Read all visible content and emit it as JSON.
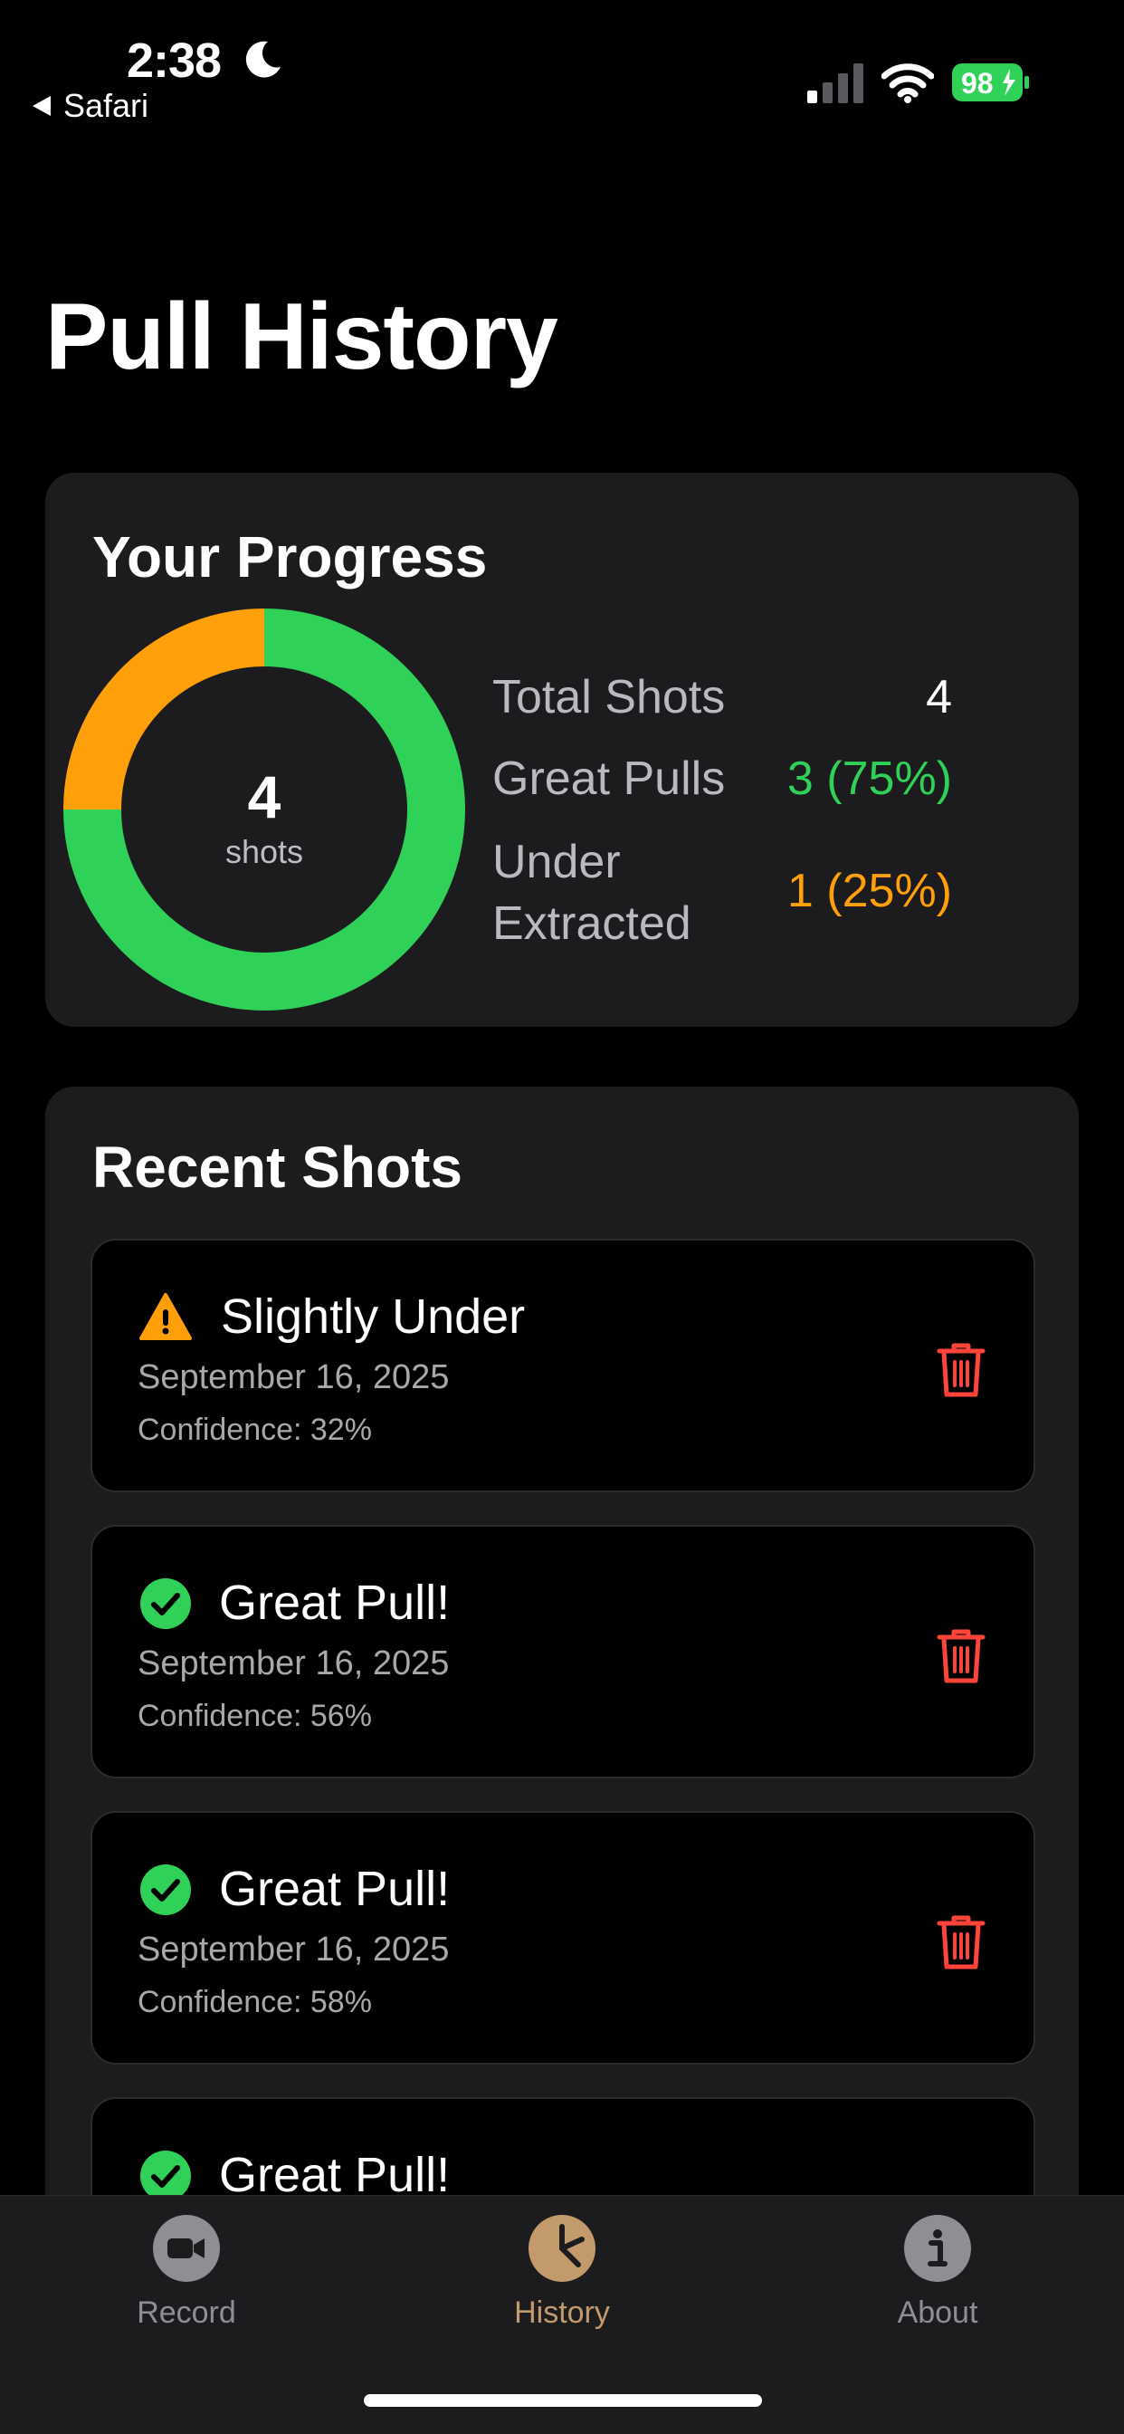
{
  "status_bar": {
    "time": "2:38",
    "back_label": "Safari",
    "battery_level": "98"
  },
  "page": {
    "title": "Pull History"
  },
  "progress": {
    "title": "Your Progress",
    "donut_count": "4",
    "donut_unit": "shots",
    "stats": [
      {
        "label": "Total Shots",
        "value": "4"
      },
      {
        "label": "Great Pulls",
        "value": "3 (75%)"
      },
      {
        "label_line1": "Under",
        "label_line2": "Extracted",
        "value": "1 (25%)"
      }
    ],
    "chart_data": {
      "type": "pie",
      "categories": [
        "Great Pulls",
        "Under Extracted"
      ],
      "values": [
        3,
        1
      ],
      "colors": [
        "#30d158",
        "#ff9f0a"
      ]
    }
  },
  "recent": {
    "title": "Recent Shots",
    "shots": [
      {
        "title": "Slightly Under",
        "date": "September 16, 2025",
        "confidence": "Confidence: 32%",
        "status_icon": "warning-triangle-icon"
      },
      {
        "title": "Great Pull!",
        "date": "September 16, 2025",
        "confidence": "Confidence: 56%",
        "status_icon": "check-circle-icon"
      },
      {
        "title": "Great Pull!",
        "date": "September 16, 2025",
        "confidence": "Confidence: 58%",
        "status_icon": "check-circle-icon"
      },
      {
        "title": "Great Pull!",
        "status_icon": "check-circle-icon"
      }
    ]
  },
  "tabs": [
    {
      "label": "Record",
      "icon": "video-camera-icon"
    },
    {
      "label": "History",
      "icon": "pie-chart-icon",
      "active": true
    },
    {
      "label": "About",
      "icon": "info-icon"
    }
  ],
  "colors": {
    "accent": "#c39a6b",
    "great": "#30d158",
    "under": "#ff9f0a",
    "delete": "#ff453a",
    "card": "#1c1c1e"
  }
}
